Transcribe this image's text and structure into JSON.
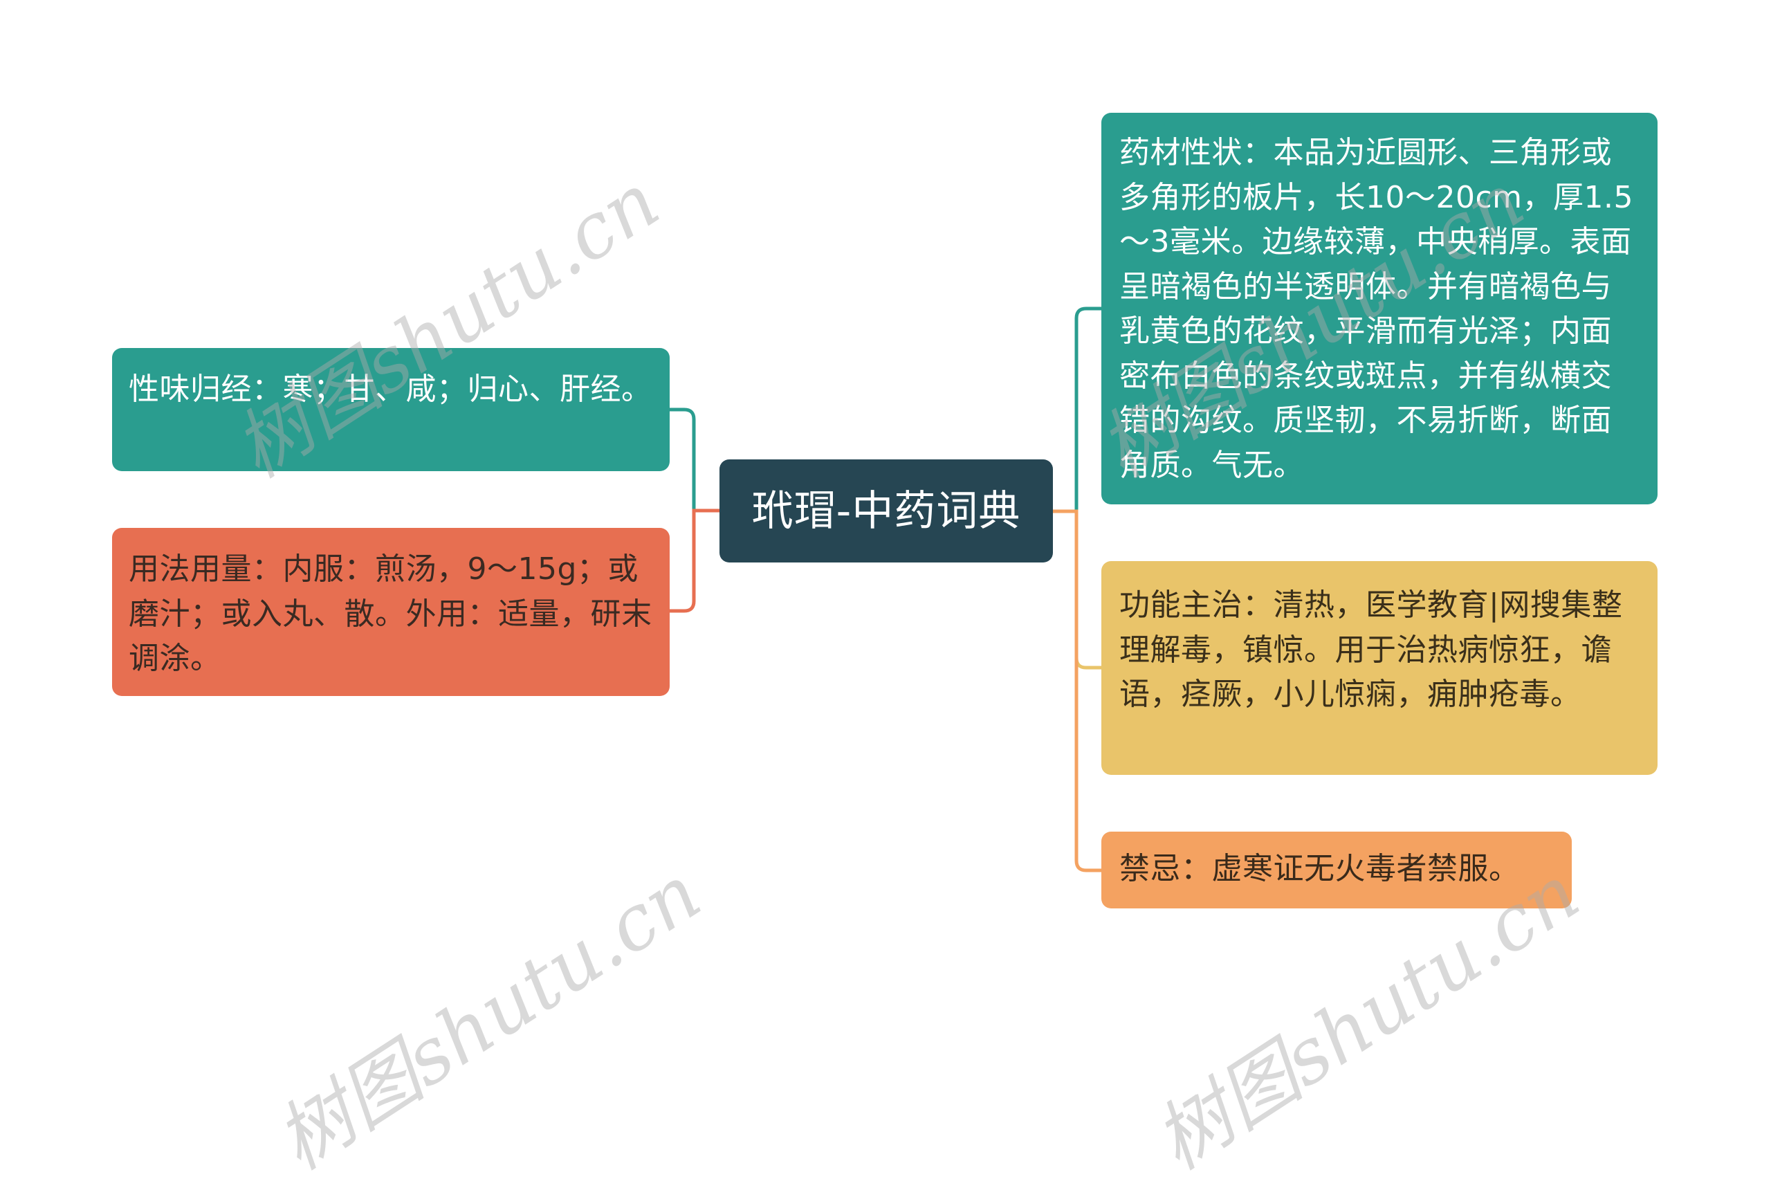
{
  "mindmap": {
    "root": {
      "label": "玳瑁-中药词典",
      "color": "#264653"
    },
    "left": [
      {
        "label": "性味归经：寒；甘、咸；归心、肝经。",
        "color": "#2a9d8f"
      },
      {
        "label": "用法用量：内服：煎汤，9～15g；或磨汁；或入丸、散。外用：适量，研末调涂。",
        "color": "#e76f51"
      }
    ],
    "right": [
      {
        "label": "药材性状：本品为近圆形、三角形或多角形的板片，长10～20cm，厚1.5～3毫米。边缘较薄，中央稍厚。表面呈暗褐色的半透明体。并有暗褐色与乳黄色的花纹，平滑而有光泽；内面密布白色的条纹或斑点，并有纵横交错的沟纹。质坚韧，不易折断，断面角质。气无。",
        "color": "#2a9d8f"
      },
      {
        "label": "功能主治：清热，医学教育|网搜集整理解毒，镇惊。用于治热病惊狂，谵语，痉厥，小儿惊痫，痈肿疮毒。",
        "color": "#e9c46a"
      },
      {
        "label": "禁忌：虚寒证无火毒者禁服。",
        "color": "#f4a261"
      }
    ]
  },
  "watermark": {
    "text": "树图shutu.cn"
  }
}
